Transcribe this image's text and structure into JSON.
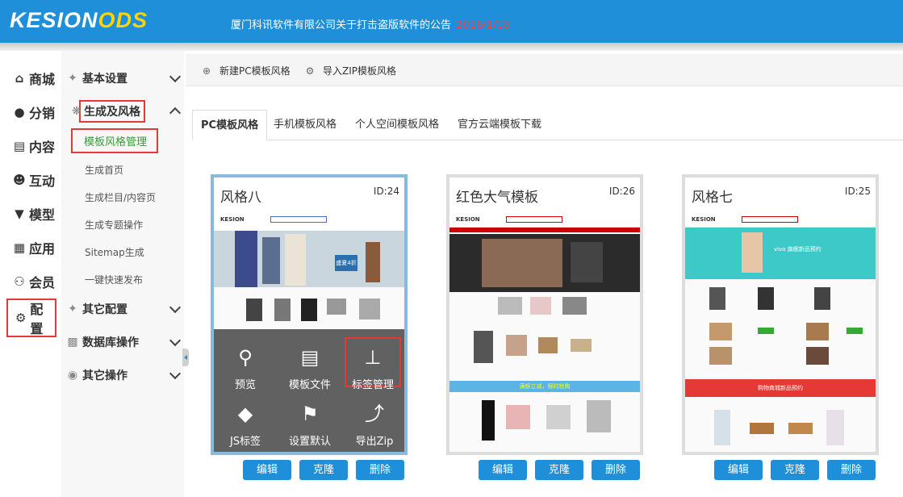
{
  "header": {
    "logo_main": "KESION",
    "logo_accent": "ODS",
    "notice": "厦门科讯软件有限公司关于打击盗版软件的公告",
    "notice_date": "2016/1/18"
  },
  "nav_primary": [
    {
      "label": "商城",
      "icon": "home-icon"
    },
    {
      "label": "分销",
      "icon": "wechat-icon"
    },
    {
      "label": "内容",
      "icon": "document-icon"
    },
    {
      "label": "互动",
      "icon": "user-icon"
    },
    {
      "label": "模型",
      "icon": "filter-icon"
    },
    {
      "label": "应用",
      "icon": "grid-icon"
    },
    {
      "label": "会员",
      "icon": "member-icon"
    },
    {
      "label": "配置",
      "icon": "gear-icon",
      "active": true
    }
  ],
  "nav_secondary": {
    "groups": [
      {
        "label": "基本设置",
        "icon": "wrench-icon"
      },
      {
        "label": "生成及风格",
        "icon": "cog-icon",
        "expanded": true
      },
      {
        "label": "其它配置",
        "icon": "wrench-icon"
      },
      {
        "label": "数据库操作",
        "icon": "bar-chart-icon"
      },
      {
        "label": "其它操作",
        "icon": "location-icon"
      }
    ],
    "subitems": [
      "模板风格管理",
      "生成首页",
      "生成栏目/内容页",
      "生成专题操作",
      "Sitemap生成",
      "一键快速发布"
    ]
  },
  "toolbar": {
    "new_pc": "新建PC模板风格",
    "import_zip": "导入ZIP模板风格"
  },
  "tabs": [
    "PC模板风格",
    "手机模板风格",
    "个人空间模板风格",
    "官方云端模板下载"
  ],
  "cards": [
    {
      "title": "风格八",
      "id": "ID:24",
      "hero_text": "盛夏4折"
    },
    {
      "title": "红色大气模板",
      "id": "ID:26",
      "promo_text": "满额立减，限时抢购"
    },
    {
      "title": "风格七",
      "id": "ID:25",
      "hero_text": "vivo 旗舰新品预约",
      "banner_text": "购物商城新品预约"
    }
  ],
  "overlay_actions": [
    {
      "label": "预览",
      "icon": "search-icon"
    },
    {
      "label": "模板文件",
      "icon": "clipboard-icon"
    },
    {
      "label": "标签管理",
      "icon": "pin-icon"
    },
    {
      "label": "JS标签",
      "icon": "tag-icon"
    },
    {
      "label": "设置默认",
      "icon": "flag-icon"
    },
    {
      "label": "导出Zip",
      "icon": "export-icon"
    }
  ],
  "card_buttons": [
    "编辑",
    "克隆",
    "删除"
  ],
  "colors": {
    "header_blue": "#1e8fd8",
    "highlight_red": "#e53935",
    "active_green": "#3a9a3a"
  }
}
